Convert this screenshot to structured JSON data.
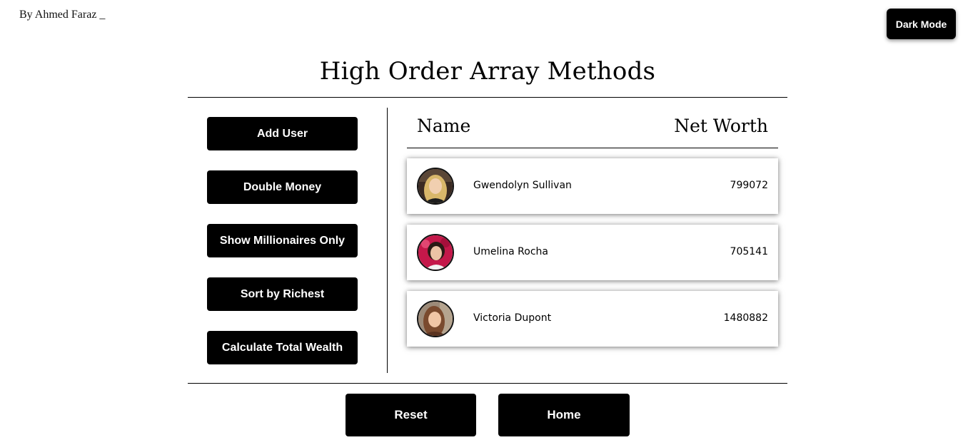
{
  "header": {
    "author": "By Ahmed Faraz _",
    "dark_mode_label": "Dark Mode"
  },
  "title": "High Order Array Methods",
  "actions": [
    {
      "label": "Add User"
    },
    {
      "label": "Double Money"
    },
    {
      "label": "Show Millionaires Only"
    },
    {
      "label": "Sort by Richest"
    },
    {
      "label": "Calculate Total Wealth"
    }
  ],
  "table": {
    "col_name": "Name",
    "col_worth": "Net Worth",
    "rows": [
      {
        "name": "Gwendolyn Sullivan",
        "worth": "799072",
        "avatar": "avatar-blonde"
      },
      {
        "name": "Umelina Rocha",
        "worth": "705141",
        "avatar": "avatar-dark-hair-red-bg"
      },
      {
        "name": "Victoria Dupont",
        "worth": "1480882",
        "avatar": "avatar-brown-hair"
      }
    ]
  },
  "footer": {
    "reset_label": "Reset",
    "home_label": "Home"
  },
  "colors": {
    "primary": "#000000",
    "background": "#ffffff",
    "button_text": "#ffffff"
  }
}
